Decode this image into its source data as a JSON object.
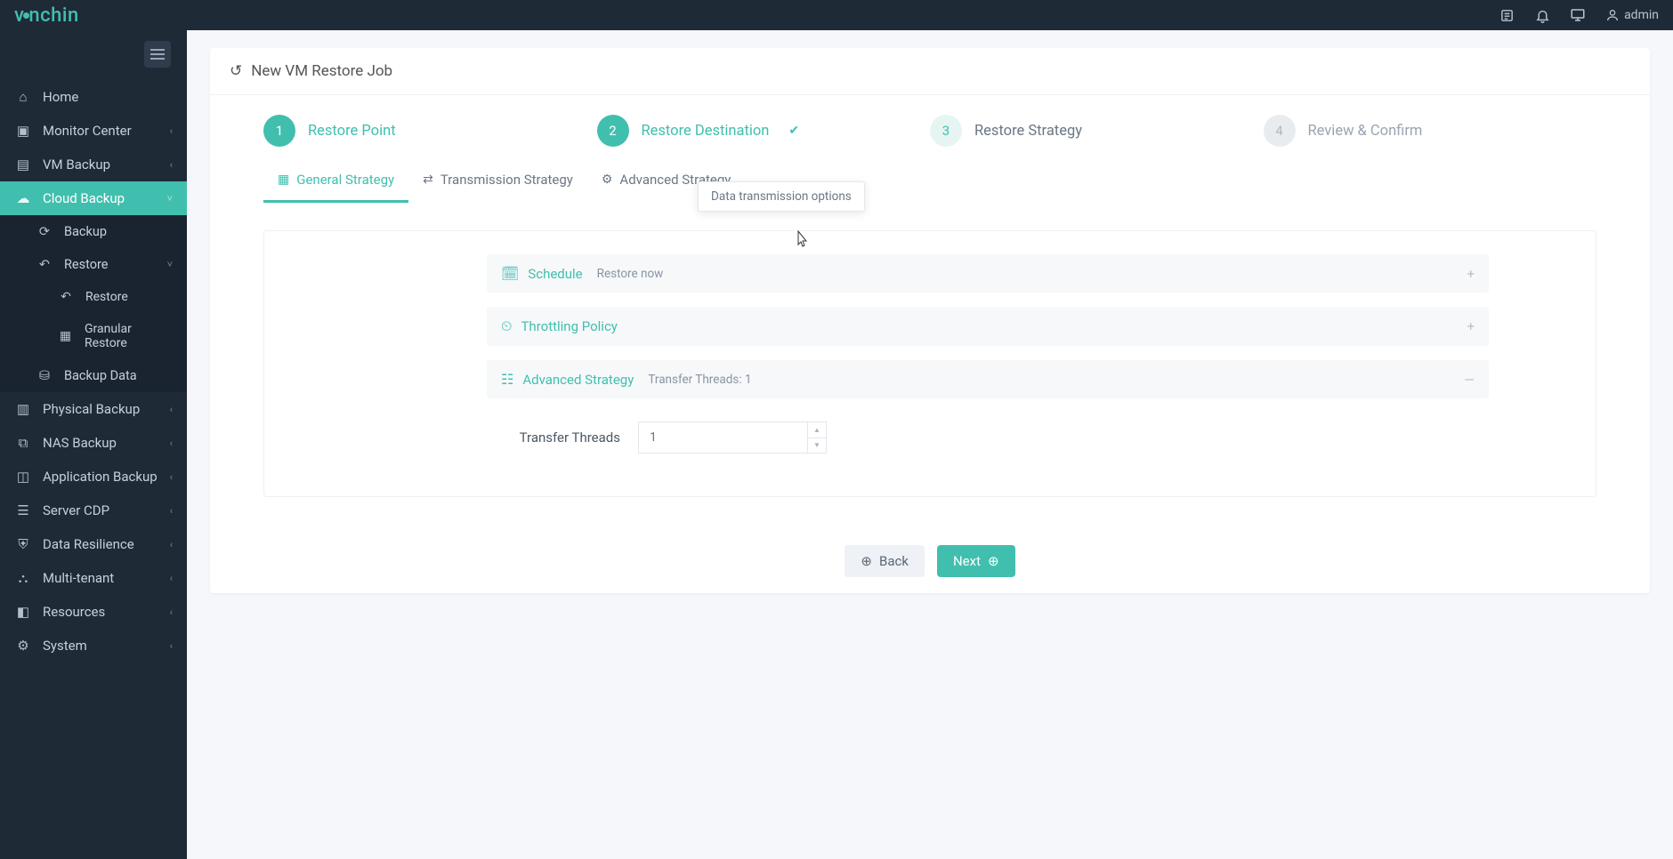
{
  "brand": "vinchin",
  "user": {
    "name": "admin"
  },
  "page": {
    "title": "New VM Restore Job"
  },
  "sidebar": {
    "items": [
      {
        "label": "Home",
        "icon": "home"
      },
      {
        "label": "Monitor Center",
        "icon": "monitor",
        "expandable": true
      },
      {
        "label": "VM Backup",
        "icon": "vm",
        "expandable": true
      },
      {
        "label": "Cloud Backup",
        "icon": "cloud",
        "expandable": true,
        "active": true,
        "children": [
          {
            "label": "Backup",
            "icon": "refresh"
          },
          {
            "label": "Restore",
            "icon": "restore-arrow",
            "expandable": true,
            "children": [
              {
                "label": "Restore",
                "icon": "restore-arrow"
              },
              {
                "label": "Granular Restore",
                "icon": "grid"
              }
            ]
          },
          {
            "label": "Backup Data",
            "icon": "data"
          }
        ]
      },
      {
        "label": "Physical Backup",
        "icon": "physical",
        "expandable": true
      },
      {
        "label": "NAS Backup",
        "icon": "nas",
        "expandable": true
      },
      {
        "label": "Application Backup",
        "icon": "app",
        "expandable": true
      },
      {
        "label": "Server CDP",
        "icon": "server",
        "expandable": true
      },
      {
        "label": "Data Resilience",
        "icon": "shield",
        "expandable": true
      },
      {
        "label": "Multi-tenant",
        "icon": "tenant",
        "expandable": true
      },
      {
        "label": "Resources",
        "icon": "resource",
        "expandable": true
      },
      {
        "label": "System",
        "icon": "gear",
        "expandable": true
      }
    ]
  },
  "stepper": {
    "steps": [
      {
        "num": "1",
        "label": "Restore Point",
        "state": "active"
      },
      {
        "num": "2",
        "label": "Restore Destination",
        "state": "done",
        "check": true
      },
      {
        "num": "3",
        "label": "Restore Strategy",
        "state": "pending"
      },
      {
        "num": "4",
        "label": "Review & Confirm",
        "state": "disabled"
      }
    ]
  },
  "tabs": [
    {
      "label": "General Strategy",
      "icon": "list",
      "active": true
    },
    {
      "label": "Transmission Strategy",
      "icon": "arrows"
    },
    {
      "label": "Advanced Strategy",
      "icon": "gear"
    }
  ],
  "tooltip": "Data transmission options",
  "accordions": {
    "schedule": {
      "title": "Schedule",
      "sub": "Restore now"
    },
    "throttling": {
      "title": "Throttling Policy"
    },
    "advanced": {
      "title": "Advanced Strategy",
      "sub": "Transfer Threads: 1"
    }
  },
  "form": {
    "transfer_threads": {
      "label": "Transfer Threads",
      "value": "1",
      "placeholder": "1"
    }
  },
  "footer": {
    "back": "Back",
    "next": "Next"
  }
}
